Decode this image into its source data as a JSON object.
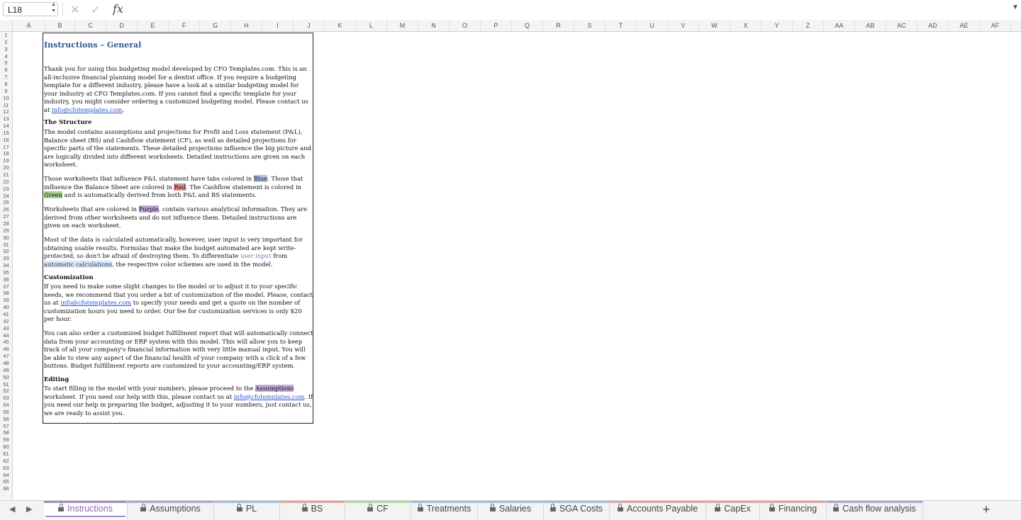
{
  "formula_bar": {
    "cell_ref": "L18",
    "formula": "",
    "cancel_icon": "x-icon",
    "confirm_icon": "check-icon",
    "fx_label": "fx"
  },
  "columns": [
    "A",
    "B",
    "C",
    "D",
    "E",
    "F",
    "G",
    "H",
    "I",
    "J",
    "K",
    "L",
    "M",
    "N",
    "O",
    "P",
    "Q",
    "R",
    "S",
    "T",
    "U",
    "V",
    "W",
    "X",
    "Y",
    "Z",
    "AA",
    "AB",
    "AC",
    "AD",
    "AE",
    "AF"
  ],
  "instructions": {
    "title": "Instructions – General",
    "p1": "Thank you for using this budgeting model developed by CFO Templates.com. This is an all-inclusive financial planning model for a dentist office. If you require a budgeting template for a different industry, please have a look at a similar budgeting model for your industry at CFO Templates.com. If you cannot find a specific template for your industry, you might consider ordering a customized budgeting model. Please contact us at ",
    "email": "info@cfotemplates.com",
    "p1_end": ".",
    "structure_heading": "The Structure",
    "p2": "The model contains assumptions and projections for Profit and Loss statement (P&L), Balance sheet (BS) and Cashflow statement (CF), as well as detailed projections for specific parts of the statements. These detailed projections influence the big picture and are logically divided into different worksheets. Detailed instructions are given on each worksheet.",
    "p3_a": "Those worksheets that influence P&L statement have tabs colored in ",
    "p3_blue": "Blue",
    "p3_b": ". Those that influence the Balance Sheet are colored in ",
    "p3_red": "Red",
    "p3_c": ". The Cashflow statement is colored in ",
    "p3_green": "Green",
    "p3_d": " and is automatically derived from both P&L and BS statements.",
    "p4_a": "Worksheets that are colored in ",
    "p4_purple": "Purple",
    "p4_b": ", contain various analytical information. They are derived from other worksheets and do not influence them. Detailed instructions are given on each worksheet.",
    "p5_a": "Most of the data is calculated automatically, however, user input is very important for obtaining usable results. Formulas that make the budget automated are kept write-protected, so don't be afraid of destroying them. To differentiate ",
    "p5_user": "user input",
    "p5_b": " from ",
    "p5_auto": "automatic calculations",
    "p5_c": ", the respective color schemes are used in the model.",
    "custom_heading": "Customization",
    "p6_a": "If you need to make some slight changes to the model or to adjust it to your specific needs, we recommend that you order a bit of customization of the model. Please, contact us at ",
    "p6_b": " to specify your needs and get a quote on the number of customization hours you need to order. Our fee for customization services is only $20 per hour.",
    "p7": "You can also order a customized budget fulfillment report that will automatically connect data from your accounting or ERP system with this model. This will allow you to keep track of all your company's financial information with very little manual input. You will be able to view any aspect of the financial health of your company with a click of a few buttons. Budget fulfillment reports are customized to your accounting/ERP system.",
    "editing_heading": "Editing",
    "p8_a": "To start filling in the model with your numbers, please proceed to the ",
    "p8_assump": "Assumptions",
    "p8_b": " worksheet. If you need our help with this, please contact us at ",
    "p8_c": ". If you need our help in preparing the budget, adjusting it to your numbers, just contact us, we are ready to assist you."
  },
  "tabs": [
    {
      "label": "Instructions",
      "color": "#a58cc6"
    },
    {
      "label": "Assumptions",
      "color": "#b9a3d4"
    },
    {
      "label": "PL",
      "color": "#a7bde0"
    },
    {
      "label": "BS",
      "color": "#e7a3a3"
    },
    {
      "label": "CF",
      "color": "#b4d9a0"
    },
    {
      "label": "Treatments",
      "color": "#a7bde0"
    },
    {
      "label": "Salaries",
      "color": "#a7bde0"
    },
    {
      "label": "SGA Costs",
      "color": "#a7bde0"
    },
    {
      "label": "Accounts Payable",
      "color": "#e7a3a3"
    },
    {
      "label": "CapEx",
      "color": "#e7a3a3"
    },
    {
      "label": "Financing",
      "color": "#e7a3a3"
    },
    {
      "label": "Cash flow analysis",
      "color": "#b9a3d4"
    }
  ],
  "add_tab_label": "+"
}
